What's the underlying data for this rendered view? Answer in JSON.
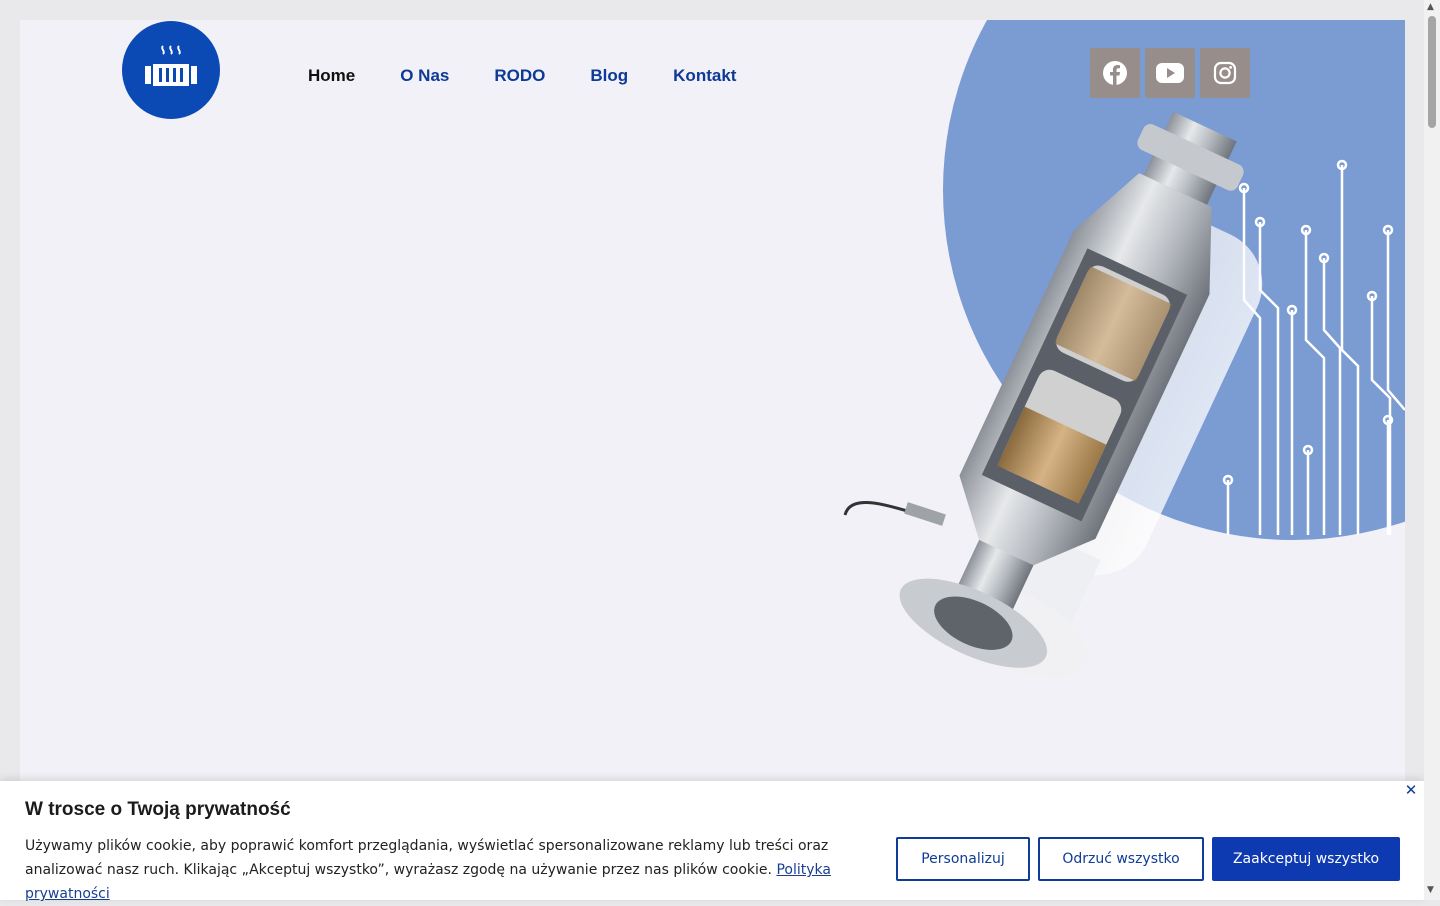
{
  "nav": {
    "items": [
      {
        "label": "Home",
        "active": true
      },
      {
        "label": "O Nas"
      },
      {
        "label": "RODO"
      },
      {
        "label": "Blog"
      },
      {
        "label": "Kontakt"
      }
    ]
  },
  "social": [
    "facebook-icon",
    "youtube-icon",
    "instagram-icon"
  ],
  "cookie": {
    "title": "W trosce o Twoją prywatność",
    "text": "Używamy plików cookie, aby poprawić komfort przeglądania, wyświetlać spersonalizowane reklamy lub treści oraz analizować nasz ruch. Klikając „Akceptuj wszystko”, wyrażasz zgodę na używanie przez nas plików cookie.",
    "link": "Polityka prywatności",
    "buttons": {
      "customize": "Personalizuj",
      "reject": "Odrzuć wszystko",
      "accept": "Zaakceptuj wszystko"
    }
  },
  "colors": {
    "brand": "#0b4ab4",
    "blob": "#7b9bd3",
    "social_bg": "#978d8a",
    "page_bg": "#f1f1f7"
  }
}
